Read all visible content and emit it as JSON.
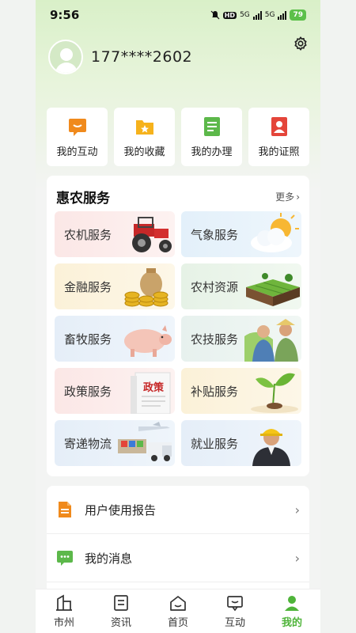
{
  "status": {
    "time": "9:56",
    "network": "5G",
    "battery": "79"
  },
  "profile": {
    "phone": "177****2602"
  },
  "quick_actions": [
    {
      "label": "我的互动",
      "icon": "chat-bubble-icon"
    },
    {
      "label": "我的收藏",
      "icon": "star-folder-icon"
    },
    {
      "label": "我的办理",
      "icon": "document-list-icon"
    },
    {
      "label": "我的证照",
      "icon": "id-card-icon"
    }
  ],
  "services": {
    "title": "惠农服务",
    "more": "更多",
    "items": [
      {
        "label": "农机服务",
        "icon": "tractor-icon"
      },
      {
        "label": "气象服务",
        "icon": "weather-icon"
      },
      {
        "label": "金融服务",
        "icon": "money-bag-icon"
      },
      {
        "label": "农村资源",
        "icon": "farmland-icon"
      },
      {
        "label": "畜牧服务",
        "icon": "pig-icon"
      },
      {
        "label": "农技服务",
        "icon": "farmers-icon"
      },
      {
        "label": "政策服务",
        "icon": "policy-document-icon",
        "badge": "政策"
      },
      {
        "label": "补贴服务",
        "icon": "seedling-icon"
      },
      {
        "label": "寄递物流",
        "icon": "logistics-icon"
      },
      {
        "label": "就业服务",
        "icon": "worker-icon"
      }
    ]
  },
  "menu": [
    {
      "label": "用户使用报告",
      "icon": "report-icon"
    },
    {
      "label": "我的消息",
      "icon": "message-icon"
    }
  ],
  "tabs": [
    {
      "label": "市州",
      "icon": "city-icon"
    },
    {
      "label": "资讯",
      "icon": "news-icon"
    },
    {
      "label": "首页",
      "icon": "home-icon"
    },
    {
      "label": "互动",
      "icon": "interaction-icon"
    },
    {
      "label": "我的",
      "icon": "profile-icon",
      "active": true
    }
  ],
  "colors": {
    "accent": "#4fb43a",
    "orange": "#f08a1c",
    "red": "#e4453a"
  }
}
